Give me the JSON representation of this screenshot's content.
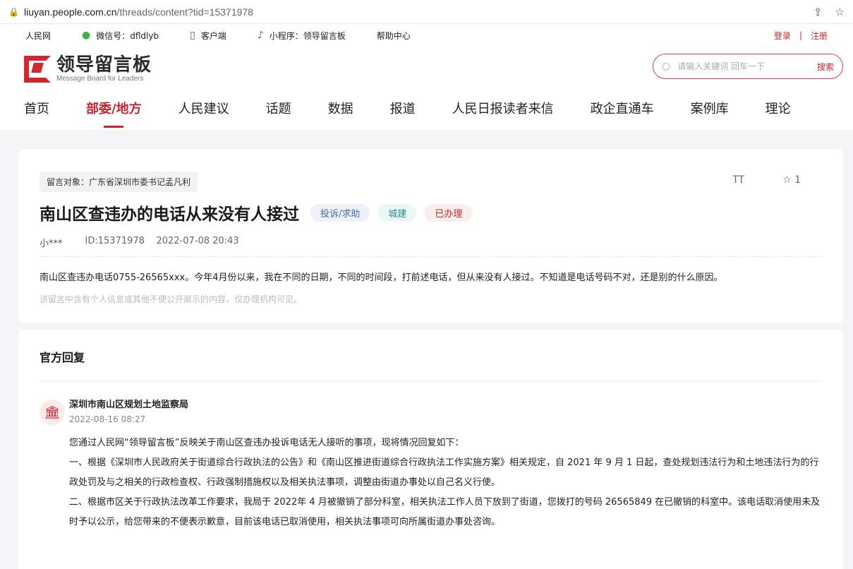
{
  "browser": {
    "url_host": "liuyan.people.com.cn",
    "url_path": "/threads/content?tid=15371978"
  },
  "topstrip": {
    "site": "人民网",
    "wechat": "微信号：dfldlyb",
    "client": "客户端",
    "miniapp": "小程序：领导留言板",
    "help": "帮助中心",
    "login": "登录",
    "separator": "|",
    "register": "注册"
  },
  "logo": {
    "cn": "领导留言板",
    "en": "Message Board for Leaders"
  },
  "search": {
    "placeholder": "请输入关键词 回车一下",
    "button": "搜索"
  },
  "nav": {
    "tabs": [
      "首页",
      "部委/地方",
      "人民建议",
      "话题",
      "数据",
      "报道",
      "人民日报读者来信",
      "政企直通车",
      "案例库",
      "理论"
    ],
    "active_index": 1
  },
  "message": {
    "target": "留言对象：广东省深圳市委书记孟凡利",
    "font_tool": "TT",
    "star_count": "1",
    "title": "南山区查违办的电话从来没有人接过",
    "badges": [
      "投诉/求助",
      "城建",
      "已办理"
    ],
    "author": "小***",
    "id": "ID:15371978",
    "time": "2022-07-08 20:43",
    "content": "南山区查违办电话0755-26565xxx。今年4月份以来，我在不同的日期，不同的时间段，打前述电话，但从来没有人接过。不知道是电话号码不对，还是别的什么原因。",
    "privacy": "该留言中含有个人信息或其他不便公开展示的内容，仅办理机构可见。"
  },
  "reply": {
    "heading": "官方回复",
    "org": "深圳市南山区规划土地监察局",
    "date": "2022-08-16 08:27",
    "p1": "您通过人民网“领导留言板”反映关于南山区查违办投诉电话无人接听的事项，现将情况回复如下：",
    "p2": "一、根据《深圳市人民政府关于街道综合行政执法的公告》和《南山区推进街道综合行政执法工作实施方案》相关规定，自 2021 年 9 月 1 日起，查处规划违法行为和土地违法行为的行政处罚及与之相关的行政检查权、行政强制措施权以及相关执法事项，调整由街道办事处以自己名义行使。",
    "p3": "二、根据市区关于行政执法改革工作要求，我局于 2022年 4 月被撤销了部分科室，相关执法工作人员下放到了街道，您拨打的号码 26565849 在已撤销的科室中。该电话取消使用未及时予以公示，给您带来的不便表示歉意，目前该电话已取消使用，相关执法事项可向所属街道办事处咨询。"
  }
}
